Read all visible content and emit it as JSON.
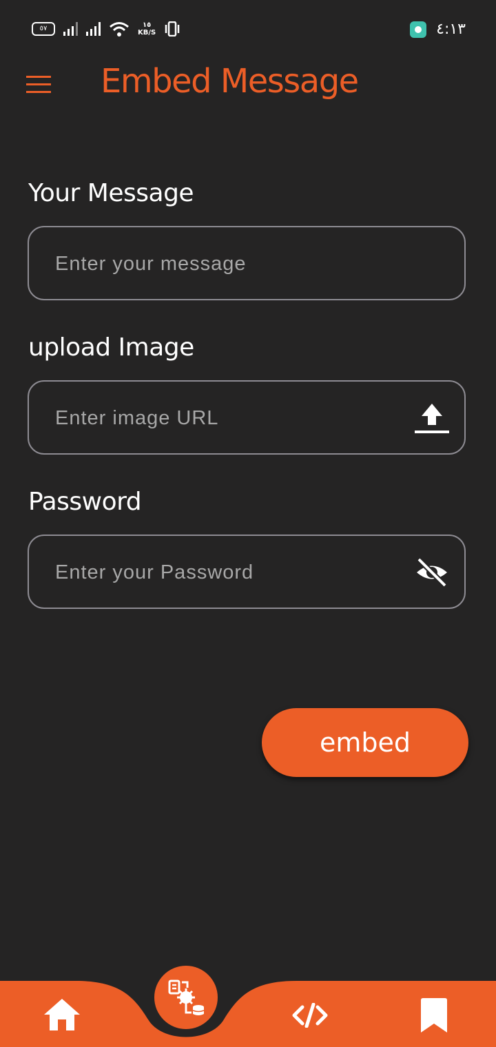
{
  "status_bar": {
    "battery": "٥٧",
    "net_speed_value": "١٥",
    "net_speed_unit": "KB/S",
    "time": "٤:١٣"
  },
  "app_bar": {
    "title": "Embed Message",
    "menu_icon": "hamburger-menu-icon"
  },
  "form": {
    "message": {
      "label": "Your Message",
      "placeholder": "Enter your message",
      "value": ""
    },
    "image": {
      "label": "upload Image",
      "placeholder": "Enter image URL",
      "value": "",
      "icon": "upload-icon"
    },
    "password": {
      "label": "Password",
      "placeholder": "Enter your Password",
      "value": "",
      "icon": "visibility-off-icon"
    }
  },
  "embed_button": {
    "label": "embed"
  },
  "bottom_nav": {
    "items": [
      {
        "icon": "home-icon"
      },
      {
        "icon": "steganography-tools-icon",
        "active": true
      },
      {
        "icon": "code-icon"
      },
      {
        "icon": "bookmark-icon"
      }
    ]
  },
  "colors": {
    "accent": "#ec5e27",
    "background": "#252424",
    "field_border": "#8e8c93",
    "placeholder": "#a8a8a8"
  }
}
